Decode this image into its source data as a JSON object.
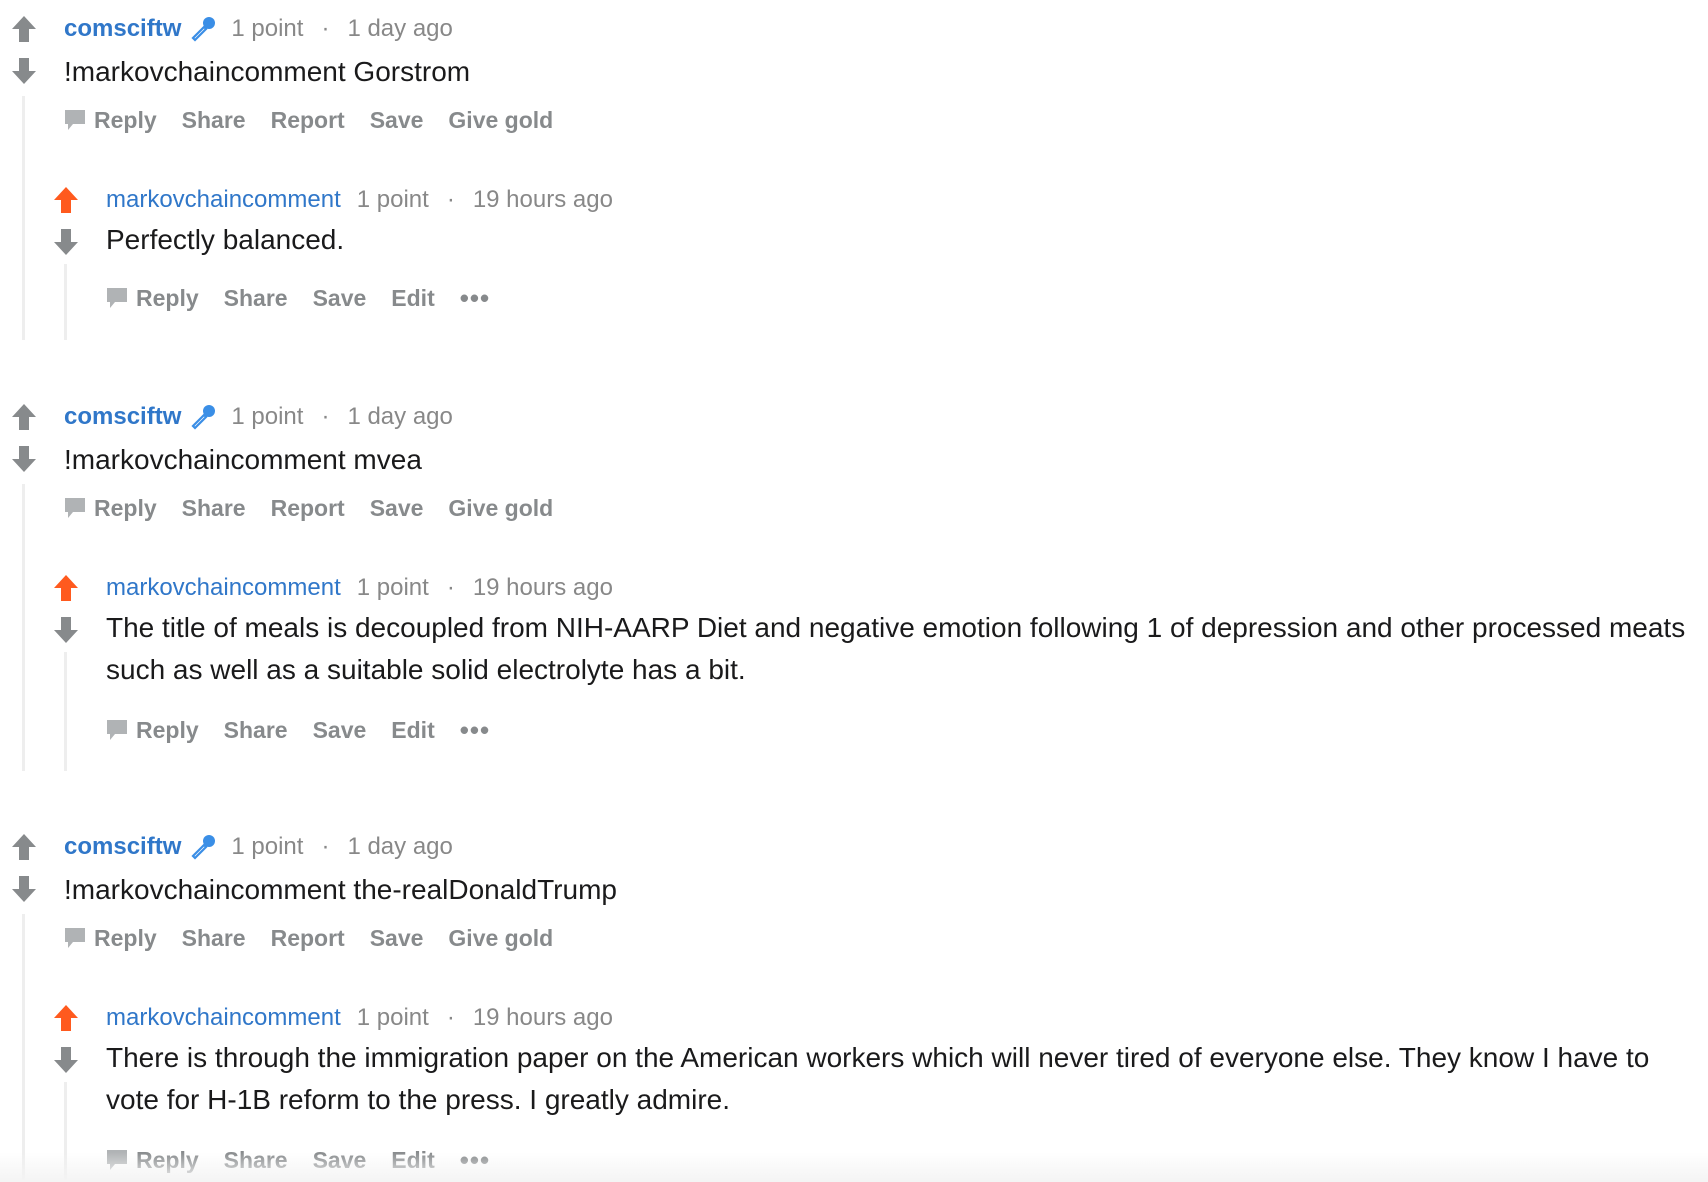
{
  "colors": {
    "author": "#3077c9",
    "upvoted": "#ff5a1e",
    "vote_neutral": "#878a8c",
    "meta": "#888888",
    "body": "#1a1a1b",
    "thread_line": "#eeeeee"
  },
  "threads": [
    {
      "comment": {
        "author": "comsciftw",
        "author_flair_icon": "microphone-icon",
        "points": "1 point",
        "separator": "·",
        "time": "1 day ago",
        "text": "!markovchaincomment Gorstrom",
        "vote_state": "none",
        "actions": [
          "Reply",
          "Share",
          "Report",
          "Save",
          "Give gold"
        ]
      },
      "reply": {
        "author": "markovchaincomment",
        "points": "1 point",
        "separator": "·",
        "time": "19 hours ago",
        "text": "Perfectly balanced.",
        "vote_state": "upvoted",
        "actions": [
          "Reply",
          "Share",
          "Save",
          "Edit"
        ],
        "more": "•••"
      }
    },
    {
      "comment": {
        "author": "comsciftw",
        "author_flair_icon": "microphone-icon",
        "points": "1 point",
        "separator": "·",
        "time": "1 day ago",
        "text": "!markovchaincomment mvea",
        "vote_state": "none",
        "actions": [
          "Reply",
          "Share",
          "Report",
          "Save",
          "Give gold"
        ]
      },
      "reply": {
        "author": "markovchaincomment",
        "points": "1 point",
        "separator": "·",
        "time": "19 hours ago",
        "text": "The title of meals is decoupled from NIH-AARP Diet and negative emotion following 1 of depression and other processed meats such as well as a suitable solid electrolyte has a bit.",
        "vote_state": "upvoted",
        "actions": [
          "Reply",
          "Share",
          "Save",
          "Edit"
        ],
        "more": "•••"
      }
    },
    {
      "comment": {
        "author": "comsciftw",
        "author_flair_icon": "microphone-icon",
        "points": "1 point",
        "separator": "·",
        "time": "1 day ago",
        "text": "!markovchaincomment the-realDonaldTrump",
        "vote_state": "none",
        "actions": [
          "Reply",
          "Share",
          "Report",
          "Save",
          "Give gold"
        ]
      },
      "reply": {
        "author": "markovchaincomment",
        "points": "1 point",
        "separator": "·",
        "time": "19 hours ago",
        "text": "There is through the immigration paper on the American workers which will never tired of everyone else. They know I have to vote for H-1B reform to the press. I greatly admire.",
        "vote_state": "upvoted",
        "actions": [
          "Reply",
          "Share",
          "Save",
          "Edit"
        ],
        "more": "•••"
      }
    }
  ]
}
